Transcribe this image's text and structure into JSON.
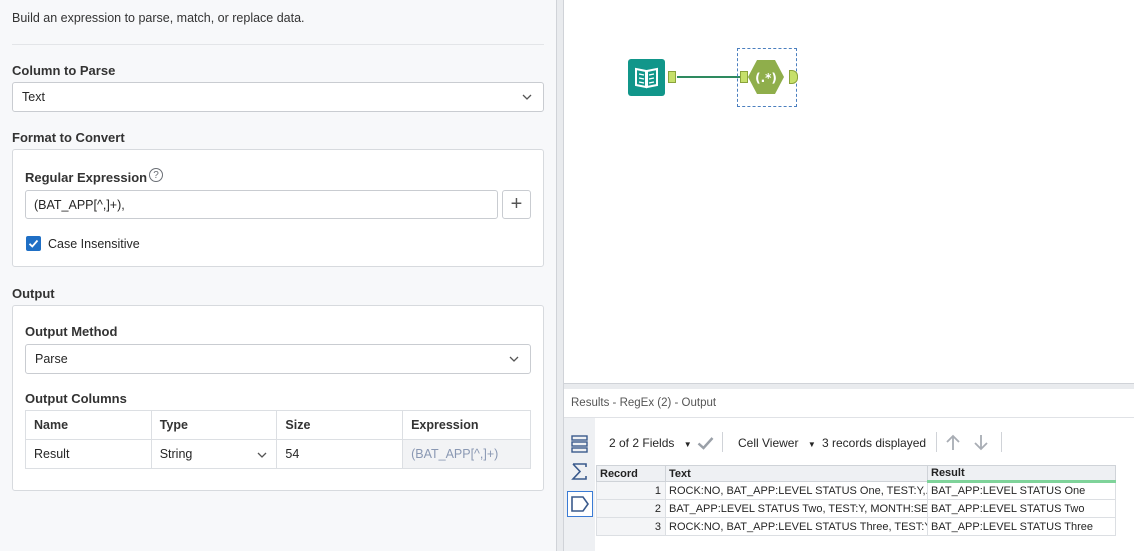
{
  "config": {
    "description": "Build an expression to parse, match, or replace data.",
    "column_to_parse": {
      "label": "Column to Parse",
      "value": "Text"
    },
    "format_to_convert": {
      "label": "Format to Convert",
      "regex_label": "Regular Expression",
      "regex_value": "(BAT_APP[^,]+),",
      "help_icon": "?",
      "add_icon": "+",
      "case_insensitive_label": "Case Insensitive",
      "case_insensitive_checked": true
    },
    "output": {
      "label": "Output",
      "method_label": "Output Method",
      "method_value": "Parse",
      "columns_label": "Output Columns",
      "table": {
        "headers": [
          "Name",
          "Type",
          "Size",
          "Expression"
        ],
        "row": {
          "name": "Result",
          "type": "String",
          "size": "54",
          "expression": "(BAT_APP[^,]+)"
        }
      }
    }
  },
  "canvas": {
    "tools": [
      "book-input-icon",
      "regex-tool-icon"
    ],
    "regex_tool_symbol": "(.*)"
  },
  "results": {
    "title": "Results - RegEx (2) - Output",
    "fields_label": "2 of 2 Fields",
    "viewer_label": "Cell Viewer",
    "records_label": "3 records displayed",
    "grid": {
      "headers": [
        "Record",
        "Text",
        "Result"
      ],
      "rows": [
        {
          "n": "1",
          "text": "ROCK:NO, BAT_APP:LEVEL STATUS One, TEST:Y,...",
          "result": "BAT_APP:LEVEL STATUS One"
        },
        {
          "n": "2",
          "text": "BAT_APP:LEVEL STATUS Two, TEST:Y, MONTH:SEP",
          "result": "BAT_APP:LEVEL STATUS Two"
        },
        {
          "n": "3",
          "text": "ROCK:NO, BAT_APP:LEVEL STATUS Three, TEST:Y,...",
          "result": "BAT_APP:LEVEL STATUS Three"
        }
      ]
    }
  },
  "colors": {
    "accent": "#1f6fc5",
    "tool_teal": "#11968a",
    "tool_green": "#8fae4b",
    "connector": "#2e8a5f"
  }
}
